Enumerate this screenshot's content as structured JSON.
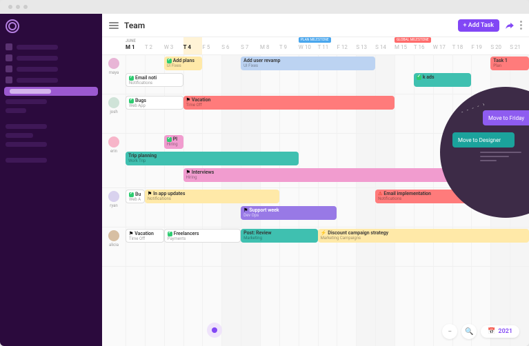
{
  "header": {
    "title": "Team",
    "month": "JUNE",
    "add_task_label": "+ Add Task"
  },
  "days": [
    {
      "label": "M 1",
      "type": "bold"
    },
    {
      "label": "T 2",
      "type": "weak"
    },
    {
      "label": "W 3",
      "type": "weak"
    },
    {
      "label": "T 4",
      "type": "bold selected"
    },
    {
      "label": "F 5",
      "type": "weak"
    },
    {
      "label": "S 6",
      "type": "weak weekend"
    },
    {
      "label": "S 7",
      "type": "weak weekend"
    },
    {
      "label": "M 8",
      "type": "weak"
    },
    {
      "label": "T 9",
      "type": "weak"
    },
    {
      "label": "W 10",
      "type": "weak",
      "milestone": "PLAN MILESTONE",
      "milestone_type": "plan"
    },
    {
      "label": "T 11",
      "type": "weak"
    },
    {
      "label": "F 12",
      "type": "weak"
    },
    {
      "label": "S 13",
      "type": "weak weekend"
    },
    {
      "label": "S 14",
      "type": "weak weekend"
    },
    {
      "label": "M 15",
      "type": "weak",
      "milestone": "GLOBAL MILESTONE",
      "milestone_type": "global"
    },
    {
      "label": "T 16",
      "type": "weak"
    },
    {
      "label": "W 17",
      "type": "weak"
    },
    {
      "label": "T 18",
      "type": "weak"
    },
    {
      "label": "F 19",
      "type": "weak"
    },
    {
      "label": "S 20",
      "type": "weak weekend"
    },
    {
      "label": "S 21",
      "type": "weak weekend"
    }
  ],
  "lanes": [
    {
      "name": "maya",
      "avatar_color": "#e8b5d6",
      "tasks": [
        {
          "title": "Add plans",
          "sub": "UI Fixes",
          "check": true,
          "color": "#ffe9a8",
          "start": 2,
          "span": 2,
          "row": 0
        },
        {
          "title": "Add user revamp",
          "sub": "UI Fixes",
          "color": "#bcd3f2",
          "start": 6,
          "span": 7,
          "row": 0
        },
        {
          "title": "Email noti",
          "sub": "Notifications",
          "check": true,
          "color": "#ffffff",
          "start": 0,
          "span": 3,
          "row": 1,
          "border": true
        },
        {
          "title": "Task 1",
          "sub": "Plan",
          "color": "#ff7b7b",
          "start": 19,
          "span": 2,
          "row": 0
        },
        {
          "title": "k ads",
          "sub": "",
          "check": true,
          "color": "#3fc0b0",
          "start": 15,
          "span": 3,
          "row": 1
        }
      ]
    },
    {
      "name": "josh",
      "avatar_color": "#cfe3d8",
      "tasks": [
        {
          "title": "Bugs",
          "sub": "Web App",
          "check": true,
          "color": "#ffffff",
          "start": 0,
          "span": 3,
          "row": 0,
          "border": true
        },
        {
          "title": "Vacation",
          "sub": "Time Off",
          "flag": true,
          "color": "#ff7b7b",
          "start": 3,
          "span": 11,
          "row": 0
        }
      ]
    },
    {
      "name": "erin",
      "avatar_color": "#f7b5c9",
      "tasks": [
        {
          "title": "Pl",
          "sub": "Hiring",
          "check": true,
          "color": "#f19ccf",
          "start": 2,
          "span": 1,
          "row": 0
        },
        {
          "title": "Trip planning",
          "sub": "Work Trip",
          "color": "#3fc0b0",
          "start": 0,
          "span": 9,
          "row": 1
        },
        {
          "title": "Interviews",
          "sub": "Hiring",
          "flag": true,
          "color": "#f19ccf",
          "start": 3,
          "span": 18,
          "row": 2
        }
      ]
    },
    {
      "name": "ryan",
      "avatar_color": "#d9d2ee",
      "tasks": [
        {
          "title": "Bu",
          "sub": "Web A",
          "check": true,
          "color": "#ffffff",
          "start": 0,
          "span": 1,
          "row": 0,
          "border": true
        },
        {
          "title": "In app updates",
          "sub": "Notifications",
          "flag": true,
          "color": "#ffe9a8",
          "start": 1,
          "span": 7,
          "row": 0
        },
        {
          "title": "Support week",
          "sub": "Dev Ops",
          "flag": true,
          "color": "#9879e6",
          "start": 6,
          "span": 5,
          "row": 1,
          "light_text": true
        },
        {
          "title": "Email implementation",
          "sub": "Notifications",
          "warn": true,
          "color": "#ff7b7b",
          "start": 13,
          "span": 8,
          "row": 0
        }
      ]
    },
    {
      "name": "alicia",
      "avatar_color": "#d7bfa3",
      "tasks": [
        {
          "title": "Vacation",
          "sub": "Time Off",
          "flag": true,
          "color": "#ffffff",
          "start": 0,
          "span": 2,
          "row": 0,
          "border": true
        },
        {
          "title": "Freelancers",
          "sub": "Payments",
          "check": true,
          "color": "#ffffff",
          "start": 2,
          "span": 4,
          "row": 0,
          "border": true
        },
        {
          "title": "Post: Review",
          "sub": "Marketing",
          "color": "#3fc0b0",
          "start": 6,
          "span": 4,
          "row": 0
        },
        {
          "title": "Discount campaign strategy",
          "sub": "Marketing Campaigns",
          "bolt": true,
          "color": "#ffe9a8",
          "start": 10,
          "span": 11,
          "row": 0
        }
      ]
    }
  ],
  "context_menu": {
    "option_friday": "Move to Friday",
    "option_designer": "Move to Designer"
  },
  "footer": {
    "year": "2021"
  }
}
